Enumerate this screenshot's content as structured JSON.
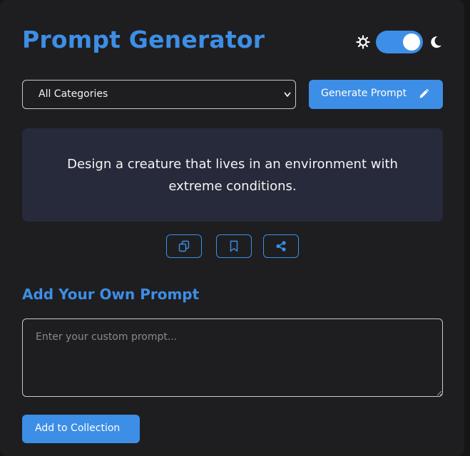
{
  "header": {
    "title": "Prompt Generator",
    "theme_toggle": {
      "state": "on",
      "accent": "#3d8ee6"
    }
  },
  "controls": {
    "category_select": {
      "selected": "All Categories"
    },
    "generate_label": "Generate Prompt"
  },
  "prompt": {
    "text": "Design a creature that lives in an environment with extreme conditions."
  },
  "actions": [
    {
      "icon": "copy-icon"
    },
    {
      "icon": "bookmark-icon"
    },
    {
      "icon": "share-icon"
    }
  ],
  "custom": {
    "heading": "Add Your Own Prompt",
    "placeholder": "Enter your custom prompt...",
    "value": "",
    "add_label": "Add to Collection"
  },
  "colors": {
    "accent": "#3d8ee6",
    "background": "#1e1e20",
    "prompt_card": "#262a3a"
  }
}
